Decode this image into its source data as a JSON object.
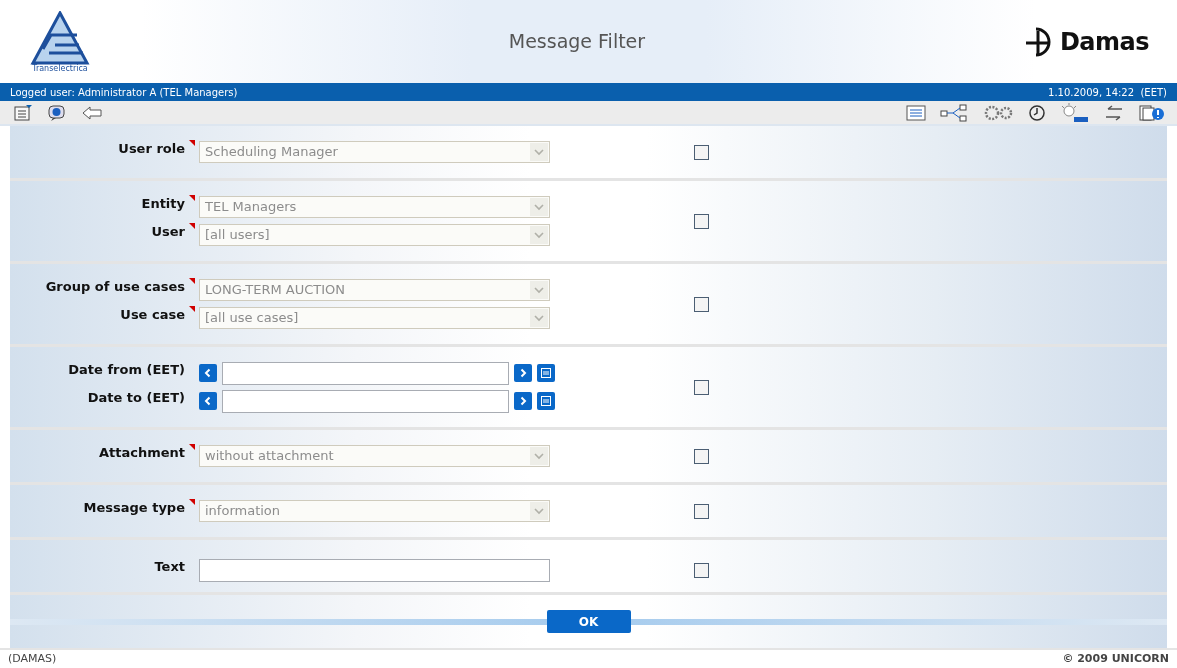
{
  "header": {
    "logo_text": "Transelectrica",
    "title": "Message Filter",
    "brand": "Damas"
  },
  "user_bar": {
    "logged_user": "Logged user: Administrator A (TEL Managers)",
    "datetime": "1.10.2009, 14:22  (EET)"
  },
  "sections": [
    {
      "checked": false,
      "rows": [
        {
          "kind": "select",
          "label": "User role",
          "required": true,
          "disabled": true,
          "value": "Scheduling Manager"
        }
      ]
    },
    {
      "checked": false,
      "rows": [
        {
          "kind": "select",
          "label": "Entity",
          "required": true,
          "disabled": true,
          "value": "TEL Managers"
        },
        {
          "kind": "select",
          "label": "User",
          "required": true,
          "disabled": true,
          "value": "[all users]"
        }
      ]
    },
    {
      "checked": false,
      "rows": [
        {
          "kind": "select",
          "label": "Group of use cases",
          "required": true,
          "disabled": true,
          "value": "LONG-TERM AUCTION"
        },
        {
          "kind": "select",
          "label": "Use case",
          "required": true,
          "disabled": true,
          "value": "[all use cases]"
        }
      ]
    },
    {
      "checked": false,
      "rows": [
        {
          "kind": "date",
          "label": "Date from (EET)",
          "required": false
        },
        {
          "kind": "date",
          "label": "Date to (EET)",
          "required": false
        }
      ]
    },
    {
      "checked": false,
      "rows": [
        {
          "kind": "select",
          "label": "Attachment",
          "required": true,
          "disabled": true,
          "value": "without attachment"
        }
      ]
    },
    {
      "checked": false,
      "rows": [
        {
          "kind": "select",
          "label": "Message type",
          "required": true,
          "disabled": true,
          "value": "information"
        }
      ]
    },
    {
      "checked": false,
      "rows": [
        {
          "kind": "text",
          "label": "Text",
          "required": false
        }
      ]
    }
  ],
  "ok_button": "OK",
  "footer": {
    "left": "(DAMAS)",
    "right": "© 2009 UNICORN"
  }
}
